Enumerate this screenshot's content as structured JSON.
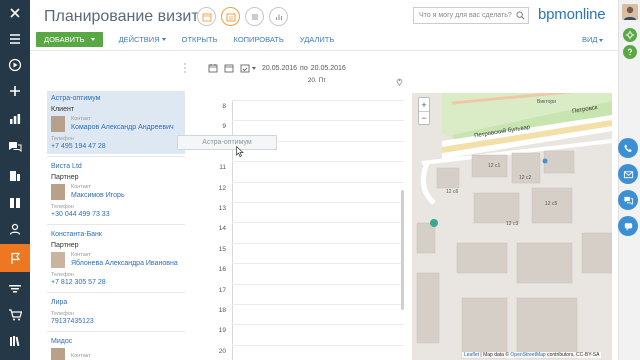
{
  "header": {
    "title": "Планирование визитов",
    "search_placeholder": "Что я могу для вас сделать?",
    "brand": "bpmonline"
  },
  "toolbar": {
    "add": "ДОБАВИТЬ",
    "actions": "ДЕЙСТВИЯ",
    "open": "ОТКРЫТЬ",
    "copy": "КОПИРОВАТЬ",
    "delete": "УДАЛИТЬ",
    "view": "ВИД"
  },
  "dates": {
    "from": "20.05.2016",
    "to_word": "по",
    "to": "20.05.2016",
    "day_header": "20. Пт"
  },
  "accounts": [
    {
      "name": "Астра-оптимум",
      "type": "Клиент",
      "contact_label": "Контакт",
      "contact": "Комаров Александр Андреевич",
      "phone_label": "Телефон",
      "phone": "+7 495 194 47 28"
    },
    {
      "name": "Виста Ltd",
      "type": "Партнер",
      "contact_label": "Контакт",
      "contact": "Максимов Игорь",
      "phone_label": "Телефон",
      "phone": "+30 044 499 73 33"
    },
    {
      "name": "Константа-Банк",
      "type": "Партнер",
      "contact_label": "Контакт",
      "contact": "Яблонева Александра Ивановна",
      "phone_label": "Телефон",
      "phone": "+7 812 305 57 28"
    },
    {
      "name": "Лира",
      "phone_label": "Телефон",
      "phone": "79137435123"
    },
    {
      "name": "Мидос",
      "contact_label": "Контакт"
    }
  ],
  "drag_ghost": "Астра-оптимум",
  "hours": [
    "8",
    "9",
    "10",
    "11",
    "12",
    "13",
    "14",
    "15",
    "16",
    "17",
    "18",
    "19",
    "20"
  ],
  "map": {
    "street": "Петровский бульвар",
    "street2": "Петровск",
    "attrib_leaflet": "Leaflet",
    "attrib_mid": " | Map data © ",
    "attrib_osm": "OpenStreetMap",
    "attrib_end": " contributors, CC-BY-SA",
    "zoom_in": "+",
    "zoom_out": "−",
    "labels": [
      "12 с1",
      "12 с3",
      "12 с2",
      "12 с5",
      "12 с6",
      "Виктори"
    ]
  },
  "colors": {
    "nav": "#253847",
    "accent": "#ee7722",
    "add_green": "#5aa845",
    "link": "#3f7cbf",
    "brand": "#2b75b8"
  }
}
